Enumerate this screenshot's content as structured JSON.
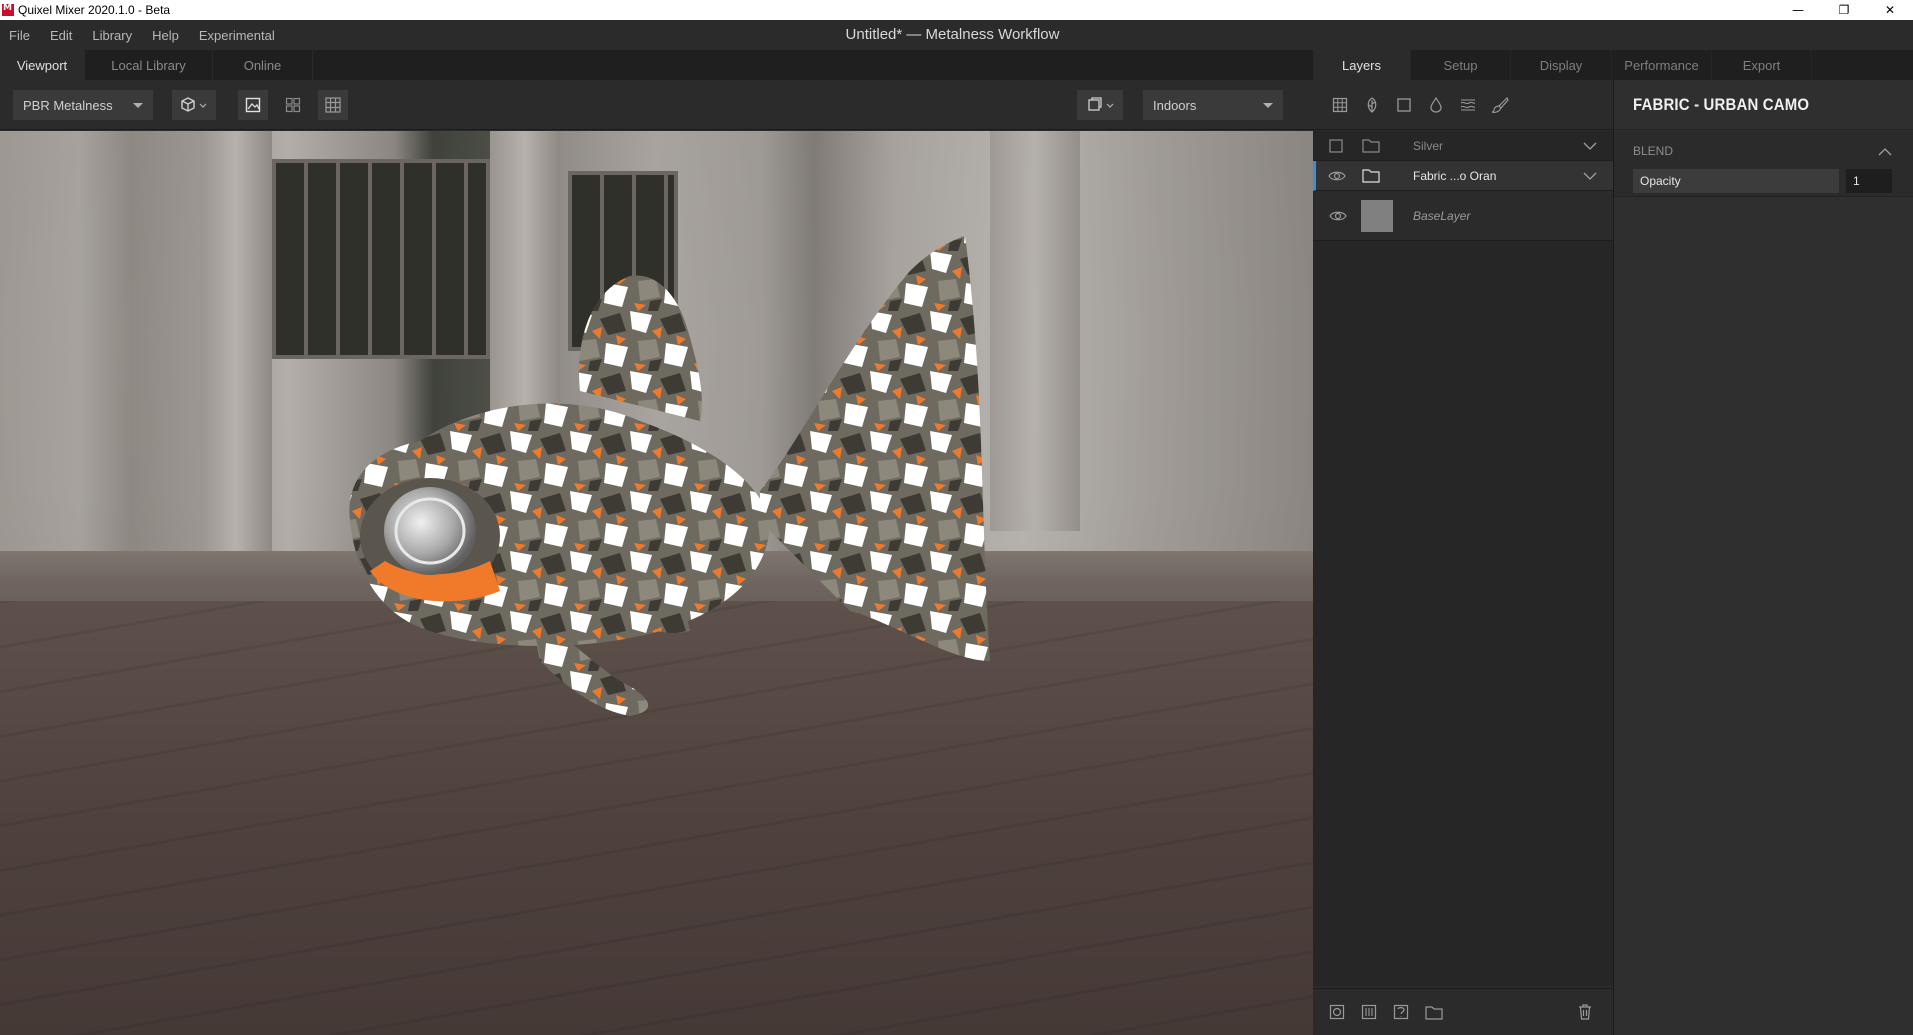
{
  "window": {
    "title": "Quixel Mixer 2020.1.0 - Beta",
    "controls": {
      "minimize": "—",
      "restore": "❐",
      "close": "✕"
    }
  },
  "menu": {
    "items": [
      "File",
      "Edit",
      "Library",
      "Help",
      "Experimental"
    ],
    "document_title": "Untitled* — Metalness Workflow"
  },
  "left_tabs": [
    "Viewport",
    "Local Library",
    "Online"
  ],
  "viewport_toolbar": {
    "workflow": "PBR Metalness",
    "environment": "Indoors"
  },
  "right_tabs": [
    "Layers",
    "Setup",
    "Display",
    "Performance",
    "Export"
  ],
  "layers": {
    "items": [
      {
        "name": "Silver",
        "visible": false,
        "type": "folder"
      },
      {
        "name": "Fabric ...o Oran",
        "visible": true,
        "type": "folder",
        "selected": true
      },
      {
        "name": "BaseLayer",
        "visible": true,
        "type": "base"
      }
    ]
  },
  "properties": {
    "title": "FABRIC - URBAN CAMO",
    "blend_label": "BLEND",
    "opacity_label": "Opacity",
    "opacity_value": "1"
  },
  "colors": {
    "accent": "#3a8fd6",
    "camo_orange": "#f07a2a",
    "panel_bg": "#2b2b2b"
  }
}
